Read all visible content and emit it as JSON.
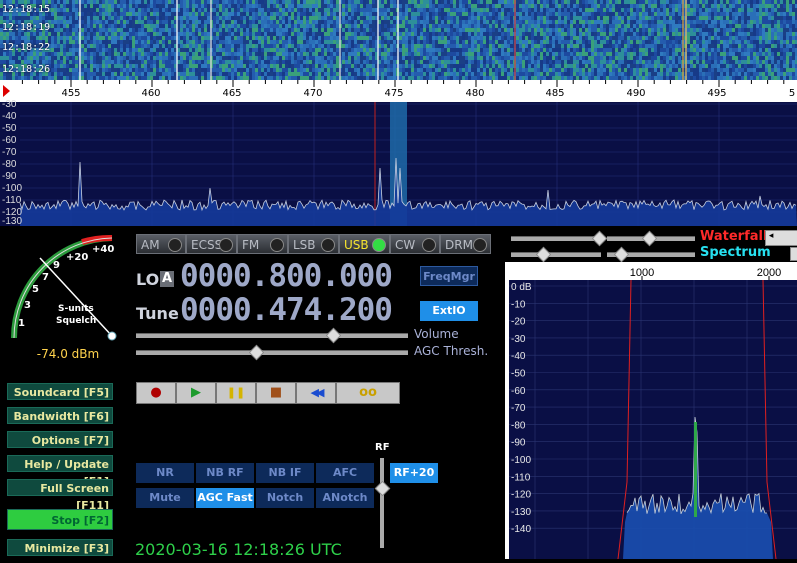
{
  "waterfall": {
    "times": [
      "12:18:15",
      "12:18:19",
      "12:18:22",
      "12:18:26"
    ]
  },
  "freq_axis": {
    "ticks": [
      "455",
      "460",
      "465",
      "470",
      "475",
      "480",
      "485",
      "490",
      "495",
      "5"
    ]
  },
  "spectrum": {
    "db_labels": [
      "-30",
      "-40",
      "-50",
      "-60",
      "-70",
      "-80",
      "-90",
      "-100",
      "-110",
      "-120",
      "-130"
    ]
  },
  "smeter": {
    "scale": [
      "1",
      "3",
      "5",
      "7",
      "9",
      "+20",
      "+40"
    ],
    "title1": "S-units",
    "title2": "Squelch",
    "reading": "-74.0 dBm",
    "level_dbm": -74.0
  },
  "left_buttons": [
    {
      "label": "Soundcard  [F5]"
    },
    {
      "label": "Bandwidth  [F6]"
    },
    {
      "label": "Options  [F7]"
    },
    {
      "label": "Help / Update  [F1]"
    },
    {
      "label": "Full Screen  [F11]"
    },
    {
      "label": "Stop  [F2]"
    },
    {
      "label": "Minimize  [F3]"
    }
  ],
  "modes": {
    "items": [
      "AM",
      "ECSS",
      "FM",
      "LSB",
      "USB",
      "CW",
      "DRM"
    ],
    "selected": "USB"
  },
  "lo": {
    "label": "LO",
    "badge": "A",
    "value": "0000.800.000",
    "button": "FreqMgr"
  },
  "tune": {
    "label": "Tune",
    "value": "0000.474.200",
    "button": "ExtIO"
  },
  "sliders": {
    "volume_label": "Volume",
    "agc_label": "AGC Thresh.",
    "rf_label": "RF",
    "rf_button": "RF+20"
  },
  "transport": {
    "record": "●",
    "play": "▶",
    "pause": "❚❚",
    "stop": "■",
    "rewind": "◀◀",
    "loop": "oo"
  },
  "dsp": {
    "row1": [
      "NR",
      "NB RF",
      "NB IF",
      "AFC"
    ],
    "row2": [
      "Mute",
      "AGC Fast",
      "Notch",
      "ANotch"
    ],
    "active": [
      "AGC Fast"
    ]
  },
  "datetime": "2020-03-16   12:18:26 UTC",
  "display_options": {
    "waterfall": "Waterfall",
    "spectrum": "Spectrum"
  },
  "zoom": {
    "x_ticks": [
      "1000",
      "2000"
    ],
    "y_labels": [
      "0 dB",
      "-10",
      "-20",
      "-30",
      "-40",
      "-50",
      "-60",
      "-70",
      "-80",
      "-90",
      "-100",
      "-110",
      "-120",
      "-130",
      "-140"
    ]
  },
  "colors": {
    "accent_green": "#2ed04a",
    "button_blue": "#1f8fe8",
    "waterfall_red": "#ff2a2a",
    "spectrum_cyan": "#27e0f0"
  }
}
